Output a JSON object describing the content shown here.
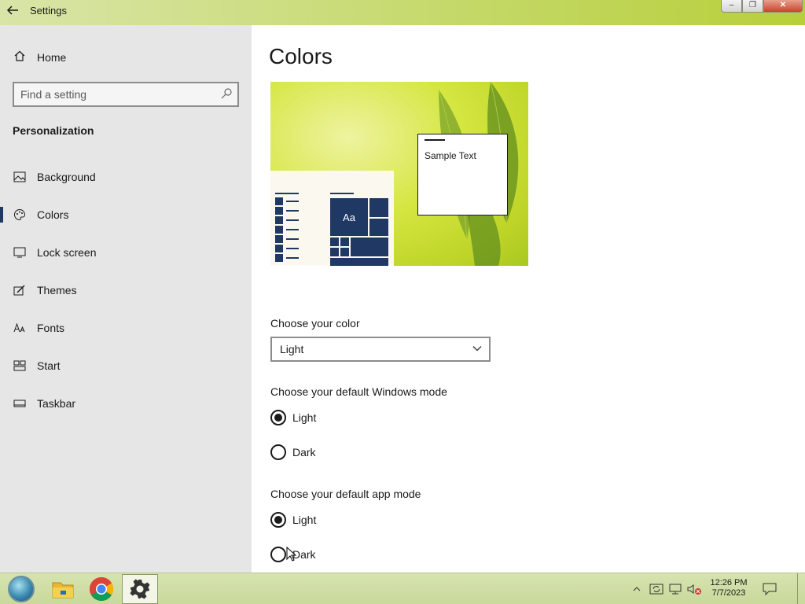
{
  "window": {
    "title": "Settings",
    "back_icon": "back-arrow-icon",
    "minimize_label": "–",
    "maximize_label": "❐",
    "close_label": "✕"
  },
  "sidebar": {
    "home_label": "Home",
    "search_placeholder": "Find a setting",
    "section_title": "Personalization",
    "items": [
      {
        "label": "Background",
        "icon": "picture-icon",
        "active": false
      },
      {
        "label": "Colors",
        "icon": "palette-icon",
        "active": true
      },
      {
        "label": "Lock screen",
        "icon": "lock-screen-icon",
        "active": false
      },
      {
        "label": "Themes",
        "icon": "brush-icon",
        "active": false
      },
      {
        "label": "Fonts",
        "icon": "fonts-icon",
        "active": false
      },
      {
        "label": "Start",
        "icon": "start-icon",
        "active": false
      },
      {
        "label": "Taskbar",
        "icon": "taskbar-icon",
        "active": false
      }
    ]
  },
  "main": {
    "title": "Colors",
    "preview": {
      "sample_text": "Sample Text",
      "tile_label": "Aa",
      "accent_color": "#1f3864"
    },
    "choose_color_label": "Choose your color",
    "choose_color_value": "Light",
    "windows_mode_label": "Choose your default Windows mode",
    "windows_mode_options": [
      {
        "label": "Light",
        "selected": true
      },
      {
        "label": "Dark",
        "selected": false
      }
    ],
    "app_mode_label": "Choose your default app mode",
    "app_mode_options": [
      {
        "label": "Light",
        "selected": true
      },
      {
        "label": "Dark",
        "selected": false
      }
    ]
  },
  "taskbar": {
    "apps": [
      "start-orb-icon",
      "file-explorer-icon",
      "chrome-icon",
      "settings-gear-icon"
    ],
    "active_app": "settings-gear-icon",
    "tray_icons": [
      "show-hidden-icons-chevron",
      "action-center-sync-icon",
      "network-icon",
      "volume-muted-icon",
      "notifications-icon"
    ],
    "time": "12:26 PM",
    "date": "7/7/2023"
  }
}
